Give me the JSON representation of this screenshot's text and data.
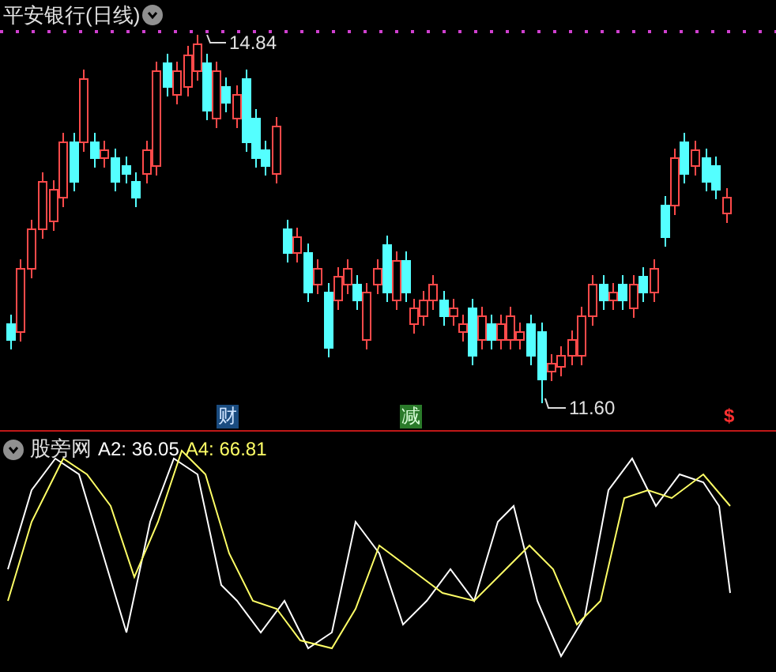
{
  "chart": {
    "title": "平安银行(日线)",
    "high_label": "14.84",
    "low_label": "11.60",
    "event_markers": [
      {
        "text": "财",
        "kind": "finance"
      },
      {
        "text": "减",
        "kind": "reduce"
      },
      {
        "text": "$",
        "kind": "dividend"
      }
    ]
  },
  "indicator": {
    "name": "股旁网",
    "values": [
      {
        "text": "A2: 36.05",
        "color": "#ffffff"
      },
      {
        "text": "A4: 66.81",
        "color": "#ffff66"
      }
    ]
  }
}
